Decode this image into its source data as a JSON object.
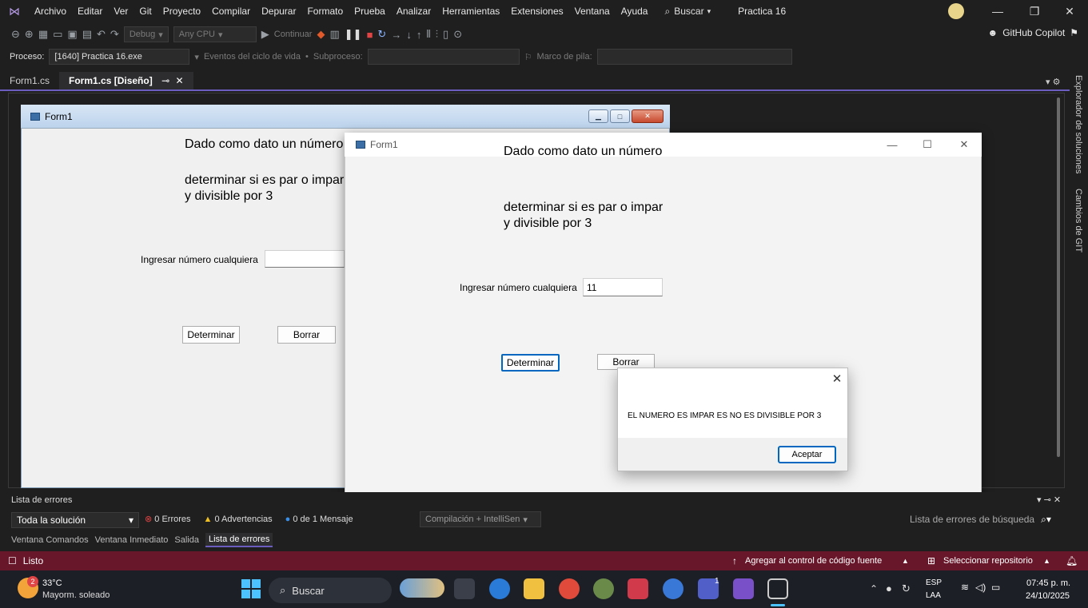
{
  "menubar": {
    "items": [
      "Archivo",
      "Editar",
      "Ver",
      "Git",
      "Proyecto",
      "Compilar",
      "Depurar",
      "Formato",
      "Prueba",
      "Analizar",
      "Herramientas",
      "Extensiones",
      "Ventana",
      "Ayuda"
    ],
    "search_label": "Buscar",
    "solution": "Practica 16"
  },
  "toolbar": {
    "config": "Debug",
    "platform": "Any CPU",
    "continue_label": "Continuar",
    "copilot": "GitHub Copilot"
  },
  "processbar": {
    "process_label": "Proceso:",
    "process_value": "[1640] Practica 16.exe",
    "lifecycle": "Eventos del ciclo de vida",
    "thread_label": "Subproceso:",
    "stack_label": "Marco de pila:"
  },
  "tabs": [
    {
      "label": "Form1.cs"
    },
    {
      "label": "Form1.cs [Diseño]"
    }
  ],
  "side_panel": {
    "explorer": "Explorador de soluciones",
    "git": "Cambios de GIT"
  },
  "design_form": {
    "title": "Form1",
    "line1": "Dado como dato un número",
    "line2": "determinar si es par o impar",
    "line3": "y divisible por 3",
    "input_label": "Ingresar número cualquiera",
    "input_value": "",
    "btn_determinar": "Determinar",
    "btn_borrar": "Borrar"
  },
  "run_form": {
    "title": "Form1",
    "line1": "Dado como dato un número",
    "line2": "determinar si es par o impar",
    "line3": "y divisible por 3",
    "input_label": "Ingresar número cualquiera",
    "input_value": "11",
    "btn_determinar": "Determinar",
    "btn_borrar": "Borrar"
  },
  "msgbox": {
    "message": "EL NUMERO ES IMPAR ES NO ES DIVISIBLE POR 3",
    "ok_label": "Aceptar"
  },
  "error_list": {
    "title": "Lista de errores",
    "scope": "Toda la solución",
    "errors": "0 Errores",
    "warnings": "0 Advertencias",
    "messages": "0 de 1 Mensaje",
    "build": "Compilación + IntelliSen",
    "search": "Lista de errores de búsqueda",
    "bottom_tabs": [
      "Ventana Comandos",
      "Ventana Inmediato",
      "Salida",
      "Lista de errores"
    ]
  },
  "statusbar": {
    "ready": "Listo",
    "add_source": "Agregar al control de código fuente",
    "select_repo": "Seleccionar repositorio"
  },
  "taskbar": {
    "weather_temp": "33°C",
    "weather_desc": "Mayorm. soleado",
    "weather_badge": "2",
    "search": "Buscar",
    "lang1": "ESP",
    "lang2": "LAA",
    "time": "07:45 p. m.",
    "date": "24/10/2025",
    "teams_badge": "1"
  },
  "colors": {
    "accent": "#6b5cc0",
    "statusbar": "#68172a",
    "error_icon": "#e04444",
    "warning_icon": "#f0c020",
    "info_icon": "#3a8ee6"
  }
}
